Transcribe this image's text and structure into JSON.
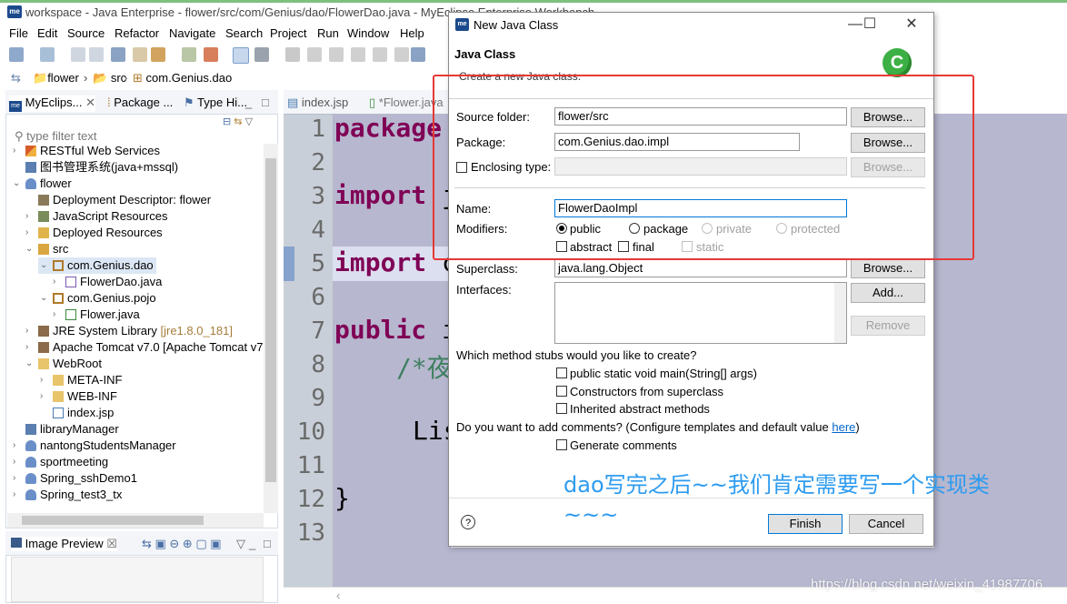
{
  "window": {
    "title": "workspace - Java Enterprise - flower/src/com/Genius/dao/FlowerDao.java - MyEclipse Enterprise Workbench",
    "app_icon_text": "me"
  },
  "menubar": [
    "File",
    "Edit",
    "Source",
    "Refactor",
    "Navigate",
    "Search",
    "Project",
    "Run",
    "Window",
    "Help"
  ],
  "breadcrumb": [
    "flower",
    "src",
    "com.Genius.dao"
  ],
  "left_view": {
    "tabs": [
      "MyEclips...",
      "Package ...",
      "Type Hi..."
    ],
    "filter_placeholder": "type filter text",
    "tree": [
      {
        "label": "RESTful Web Services",
        "icon": "rest-services-icon"
      },
      {
        "label": "图书管理系统(java+mssql)",
        "icon": "project-icon"
      },
      {
        "label": "flower",
        "icon": "web-project-icon"
      },
      {
        "label": "Deployment Descriptor: flower",
        "icon": "descriptor-icon"
      },
      {
        "label": "JavaScript Resources",
        "icon": "js-resources-icon"
      },
      {
        "label": "Deployed Resources",
        "icon": "deployed-resources-icon"
      },
      {
        "label": "src",
        "icon": "source-folder-icon"
      },
      {
        "label": "com.Genius.dao",
        "icon": "package-icon"
      },
      {
        "label": "FlowerDao.java",
        "icon": "java-interface-icon"
      },
      {
        "label": "com.Genius.pojo",
        "icon": "package-icon"
      },
      {
        "label": "Flower.java",
        "icon": "java-class-icon"
      },
      {
        "label": "JRE System Library",
        "decor": "[jre1.8.0_181]",
        "icon": "library-icon"
      },
      {
        "label": "Apache Tomcat v7.0 [Apache Tomcat v7",
        "icon": "library-icon"
      },
      {
        "label": "WebRoot",
        "icon": "folder-icon"
      },
      {
        "label": "META-INF",
        "icon": "folder-icon"
      },
      {
        "label": "WEB-INF",
        "icon": "folder-icon"
      },
      {
        "label": "index.jsp",
        "icon": "jsp-file-icon"
      },
      {
        "label": "libraryManager",
        "icon": "project-icon"
      },
      {
        "label": "nantongStudentsManager",
        "icon": "web-project-icon"
      },
      {
        "label": "sportmeeting",
        "icon": "web-project-icon"
      },
      {
        "label": "Spring_sshDemo1",
        "icon": "web-project-icon"
      },
      {
        "label": "Spring_test3_tx",
        "icon": "web-project-icon"
      }
    ]
  },
  "image_preview": {
    "tab": "Image Preview"
  },
  "editor": {
    "tabs": [
      "index.jsp",
      "*Flower.java"
    ],
    "line_numbers": [
      "1",
      "2",
      "3",
      "4",
      "5",
      "6",
      "7",
      "8",
      "9",
      "10",
      "11",
      "12",
      "13"
    ],
    "code": {
      "l1_kw": "package",
      "l3_kw": "import",
      "l3_rest": " j",
      "l5_kw": "import",
      "l5_rest": " c",
      "l7_kw": "public",
      "l7_rest": " i",
      "l8": "/*夜",
      "l10": "Lis",
      "l12": "}"
    }
  },
  "dialog": {
    "title": "New Java Class",
    "header_title": "Java Class",
    "header_desc": "Create a new Java class.",
    "source_folder": {
      "label": "Source folder:",
      "value": "flower/src",
      "button": "Browse..."
    },
    "package": {
      "label": "Package:",
      "value": "com.Genius.dao.impl",
      "button": "Browse..."
    },
    "enclosing_type": {
      "label": "Enclosing type:",
      "value": "",
      "button": "Browse..."
    },
    "name": {
      "label": "Name:",
      "value": "FlowerDaoImpl"
    },
    "modifiers": {
      "label": "Modifiers:",
      "radios": [
        "public",
        "package",
        "private",
        "protected"
      ],
      "selected": "public",
      "checks": [
        "abstract",
        "final",
        "static"
      ]
    },
    "superclass": {
      "label": "Superclass:",
      "value": "java.lang.Object",
      "button": "Browse..."
    },
    "interfaces": {
      "label": "Interfaces:",
      "add": "Add...",
      "remove": "Remove"
    },
    "stubs_question": "Which method stubs would you like to create?",
    "stubs": [
      "public static void main(String[] args)",
      "Constructors from superclass",
      "Inherited abstract methods"
    ],
    "comments_question": "Do you want to add comments? (Configure templates and default value ",
    "comments_link": "here",
    "comments_close": ")",
    "generate_comments": "Generate comments",
    "finish": "Finish",
    "cancel": "Cancel"
  },
  "annotation": {
    "line1": "dao写完之后~~我们肯定需要写一个实现类",
    "line2": "~~~"
  },
  "watermark": "https://blog.csdn.net/weixin_41987706"
}
